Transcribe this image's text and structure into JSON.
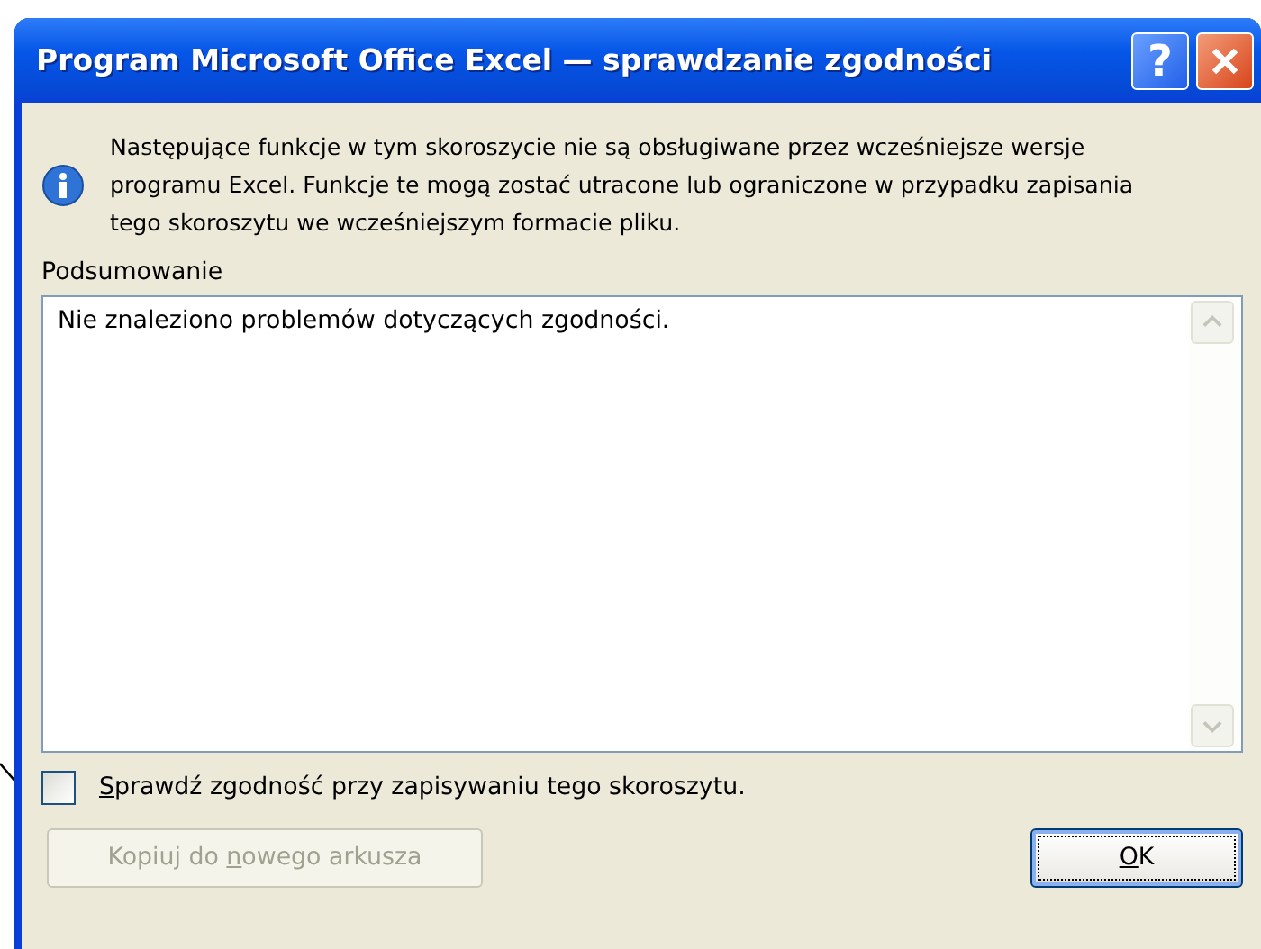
{
  "window": {
    "title": "Program Microsoft Office Excel — sprawdzanie zgodności",
    "buttons": [
      {
        "kind": "help",
        "glyph": "?"
      },
      {
        "kind": "close"
      }
    ]
  },
  "message": "Następujące funkcje w tym skoroszycie nie są obsługiwane przez wcześniejsze wersje programu Excel. Funkcje te mogą zostać utracone lub ograniczone w przypadku zapisania tego skoroszytu we wcześniejszym formacie pliku.",
  "summary": {
    "label": "Podsumowanie",
    "text": "Nie znaleziono problemów dotyczących zgodności."
  },
  "check_option": {
    "access_key": "S",
    "label_after": "prawdź zgodność przy zapisywaniu tego skoroszytu.",
    "checked": false
  },
  "buttons": [
    {
      "label_before": "Kopiuj do ",
      "access_key": "n",
      "label_after": "owego arkusza",
      "disabled": true,
      "default": false
    },
    {
      "access_key": "O",
      "label_after": "K",
      "disabled": false,
      "default": true
    }
  ]
}
